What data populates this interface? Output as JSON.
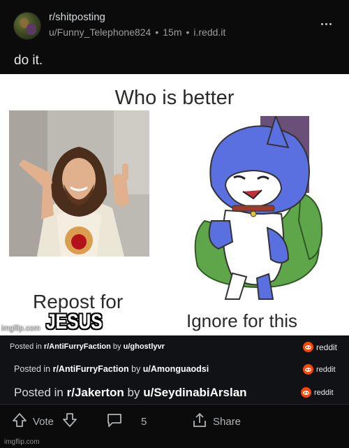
{
  "post": {
    "subreddit": "r/shitposting",
    "author": "u/Funny_Telephone824",
    "age": "15m",
    "domain": "i.redd.it",
    "title": "do it."
  },
  "meme": {
    "heading": "Who is better",
    "left_label": "Repost for",
    "left_caption": "JESUS",
    "right_label": "Ignore for this",
    "watermark": "imgflip.com"
  },
  "repost_rows": [
    {
      "prefix": "Posted in ",
      "subreddit": "r/AntiFurryFaction",
      "middle": " by ",
      "user": "u/ghostlyvr",
      "badge": "reddit"
    },
    {
      "prefix": "Posted in ",
      "subreddit": "r/AntiFurryFaction",
      "middle": " by ",
      "user": "u/Amonguaodsi",
      "badge": "reddit"
    },
    {
      "prefix": "Posted in ",
      "subreddit": "r/Jakerton",
      "middle": " by ",
      "user": "u/SeydinabiArslan",
      "badge": "reddit"
    }
  ],
  "actions": {
    "vote_label": "Vote",
    "comment_count": "5",
    "share_label": "Share"
  },
  "footer": {
    "watermark": "imgflip.com"
  },
  "colors": {
    "background": "#0b0b0b",
    "reddit_orange": "#ff4500",
    "text": "#d7dadc"
  },
  "icons": [
    "more-icon",
    "upvote-icon",
    "downvote-icon",
    "comment-icon",
    "share-icon",
    "reddit-logo-icon"
  ]
}
